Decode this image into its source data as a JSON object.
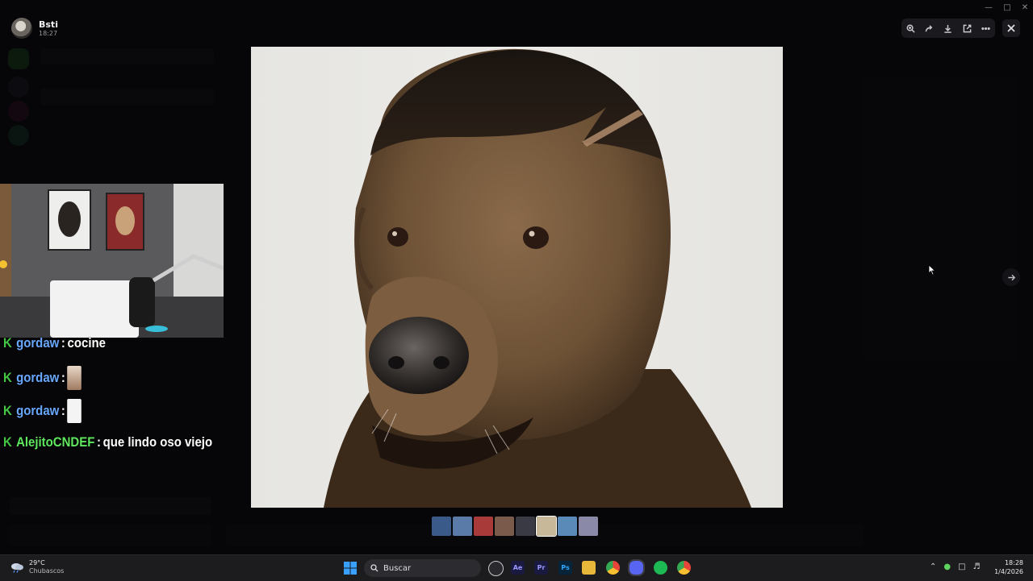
{
  "user": {
    "name": "Bsti",
    "time": "18:27"
  },
  "viewer": {
    "toolbar_icons": [
      "zoom-in-icon",
      "forward-icon",
      "download-icon",
      "open-external-icon",
      "more-icon"
    ],
    "close_icon": "close-icon",
    "next_icon": "arrow-right-icon",
    "thumbnail_count": 8
  },
  "chat": {
    "messages": [
      {
        "user": "gordaw",
        "separator": ":",
        "text": "cocine"
      },
      {
        "user": "gordaw",
        "separator": ":",
        "text": ""
      },
      {
        "user": "gordaw",
        "separator": ":",
        "text": ""
      },
      {
        "user": "AlejitoCNDEF",
        "separator": ":",
        "text": "que lindo oso viejo"
      }
    ]
  },
  "taskbar": {
    "weather_temp": "29°C",
    "weather_desc": "Chubascos",
    "search_label": "Buscar",
    "apps": [
      {
        "label": "Ae",
        "color": "#1a1a40",
        "fg": "#9999ff"
      },
      {
        "label": "Pr",
        "color": "#1a1a40",
        "fg": "#9999ff"
      },
      {
        "label": "Ps",
        "color": "#06243a",
        "fg": "#31a8ff"
      }
    ],
    "time": "18:28",
    "date": "1/4/2026"
  }
}
